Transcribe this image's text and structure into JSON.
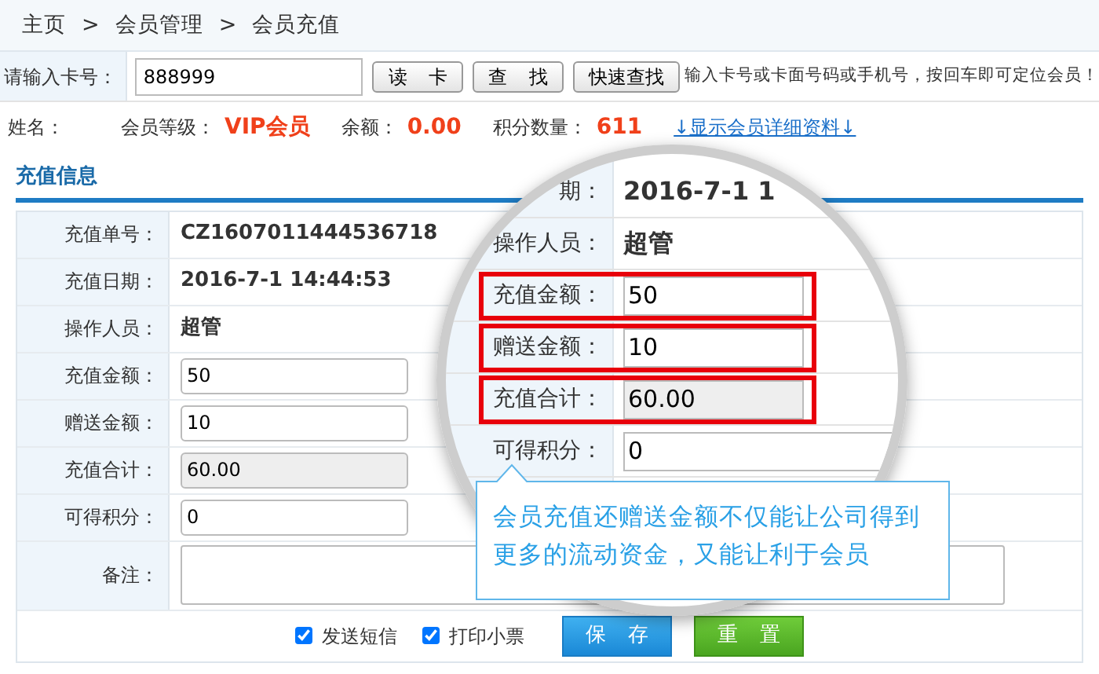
{
  "breadcrumb": {
    "items": [
      "主页",
      "会员管理",
      "会员充值"
    ],
    "separators": [
      ">",
      ">"
    ]
  },
  "search": {
    "label": "请输入卡号：",
    "value": "888999",
    "buttons": [
      "读 卡",
      "查 找",
      "快速查找"
    ],
    "hint": "输入卡号或卡面号码或手机号，按回车即可定位会员！"
  },
  "member": {
    "fields": [
      {
        "label": "姓名："
      },
      {
        "label": "会员等级：",
        "value": "VIP会员"
      },
      {
        "label": "余额：",
        "value": "0.00"
      },
      {
        "label": "积分数量：",
        "value": "611"
      }
    ],
    "detail_link": "↓显示会员详细资料↓"
  },
  "section_title": "充值信息",
  "form": {
    "rows": [
      {
        "kind": "text",
        "label": "充值单号：",
        "value": "CZ1607011444536718"
      },
      {
        "kind": "text",
        "label": "充值日期：",
        "value": "2016-7-1 14:44:53"
      },
      {
        "kind": "text",
        "label": "操作人员：",
        "value": "超管"
      },
      {
        "kind": "input",
        "label": "充值金额：",
        "value": "50"
      },
      {
        "kind": "input",
        "label": "赠送金额：",
        "value": "10"
      },
      {
        "kind": "readonly",
        "label": "充值合计：",
        "value": "60.00"
      },
      {
        "kind": "input",
        "label": "可得积分：",
        "value": "0"
      },
      {
        "kind": "textarea",
        "label": "备注："
      }
    ],
    "options": [
      {
        "label": "发送短信",
        "checked": true
      },
      {
        "label": "打印小票",
        "checked": true
      }
    ],
    "buttons": [
      {
        "kind": "primary",
        "label": "保 存"
      },
      {
        "kind": "reset",
        "label": "重 置"
      }
    ]
  },
  "magnifier": {
    "rows": [
      {
        "kind": "text",
        "label": "期：",
        "value": "2016-7-1 1",
        "highlighted": false
      },
      {
        "kind": "text",
        "label": "操作人员：",
        "value": "超管",
        "highlighted": false
      },
      {
        "kind": "input",
        "label": "充值金额：",
        "value": "50",
        "highlighted": true
      },
      {
        "kind": "input",
        "label": "赠送金额：",
        "value": "10",
        "highlighted": true
      },
      {
        "kind": "readonly",
        "label": "充值合计：",
        "value": "60.00",
        "highlighted": true
      },
      {
        "kind": "input",
        "label": "可得积分：",
        "value": "0",
        "highlighted": false
      }
    ],
    "callout": "会员充值还赠送金额不仅能让公司得到更多的流动资金，又能让利于会员"
  }
}
